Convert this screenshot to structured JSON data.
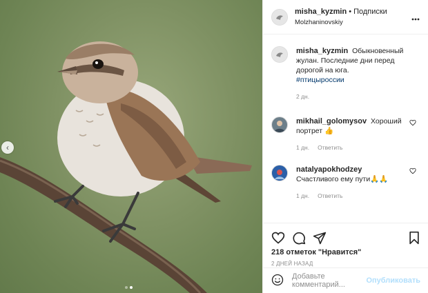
{
  "header": {
    "username": "misha_kyzmin",
    "separator": "•",
    "follow_label": "Подписки",
    "location": "Molzhaninovskiy"
  },
  "caption": {
    "username": "misha_kyzmin",
    "text": "Обыкновенный жулан. Последние дни перед дорогой на юга.",
    "hashtag": "#птицыроссии",
    "time": "2 дн."
  },
  "comments": [
    {
      "username": "mikhail_golomysov",
      "text": "Хороший портрет 👍",
      "time": "1 дн.",
      "reply": "Ответить"
    },
    {
      "username": "natalyapokhodzey",
      "text": "Счастливого ему пути🙏🙏",
      "time": "1 дн.",
      "reply": "Ответить"
    }
  ],
  "likes_text": "218 отметок \"Нравится\"",
  "posted_ago": "2 ДНЕЙ НАЗАД",
  "add_comment": {
    "placeholder": "Добавьте комментарий...",
    "post_label": "Опубликовать"
  },
  "icons": [
    "chevron-left-icon",
    "heart-icon",
    "comment-icon",
    "share-icon",
    "bookmark-icon",
    "emoji-icon",
    "more-icon"
  ],
  "colors": {
    "hashtag": "#00376b",
    "meta": "#8e8e8e",
    "post_disabled": "#b2dffc"
  },
  "carousel": {
    "count": 2,
    "active": 2
  }
}
